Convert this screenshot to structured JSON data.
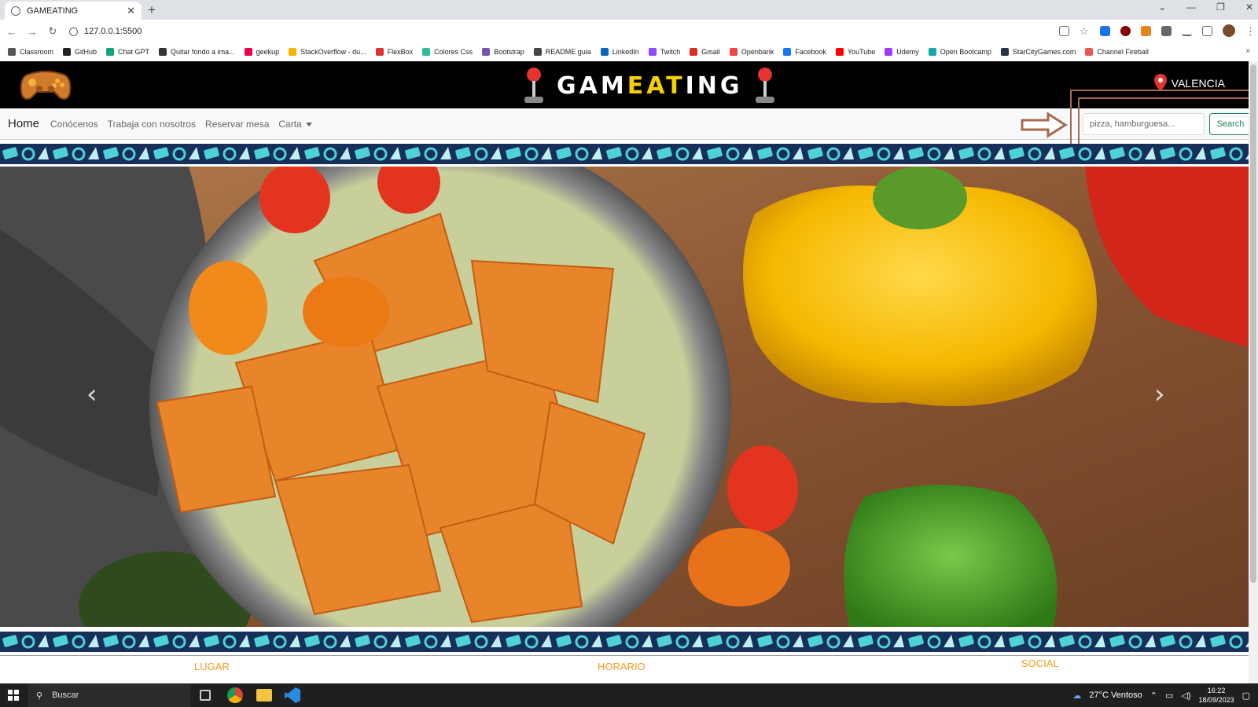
{
  "browser": {
    "tab_title": "GAMEATING",
    "tab_close": "✕",
    "new_tab": "+",
    "url": "127.0.0.1:5500",
    "bookmarks": [
      "Classroom",
      "GitHub",
      "Chat GPT",
      "Quitar fondo a ima...",
      "geekup",
      "StackOverflow - du...",
      "FlexBox",
      "Colores Css",
      "Bootstrap",
      "README guia",
      "LinkedIn",
      "Twitch",
      "Gmail",
      "Openbank",
      "Facebook",
      "YouTube",
      "Udemy",
      "Open Bootcamp",
      "StarCityGames.com",
      "Channel Fireball"
    ],
    "bookmark_colors": [
      "#555",
      "#222",
      "#10a37f",
      "#333",
      "#e05",
      "#f5b400",
      "#d33",
      "#3b9",
      "#7952b3",
      "#444",
      "#0a66c2",
      "#9146ff",
      "#d93025",
      "#e44",
      "#1877f2",
      "#ff0000",
      "#a435f0",
      "#1aa",
      "#234",
      "#e55"
    ]
  },
  "site": {
    "brand_left": "GAM",
    "brand_mid": "EAT",
    "brand_right": "ING",
    "location": "VALENCIA",
    "nav": {
      "home": "Home",
      "links": [
        "Conócenos",
        "Trabaja con nosotros",
        "Reservar mesa"
      ],
      "dropdown": "Carta"
    },
    "search": {
      "placeholder": "pizza, hamburguesa...",
      "button": "Search"
    },
    "carousel": {
      "prev": "‹",
      "next": "›"
    },
    "footer": [
      "LUGAR",
      "HORARIO",
      "SOCIAL"
    ]
  },
  "taskbar": {
    "search": "Buscar",
    "weather": "27°C  Ventoso",
    "time": "16:22",
    "date": "18/09/2023"
  },
  "colors": {
    "accent_yellow": "#f5d000",
    "footer_orange": "#f29a1e",
    "search_green": "#198754",
    "highlight_brown": "#a86a4e",
    "pattern_teal": "#4fd1d9"
  }
}
